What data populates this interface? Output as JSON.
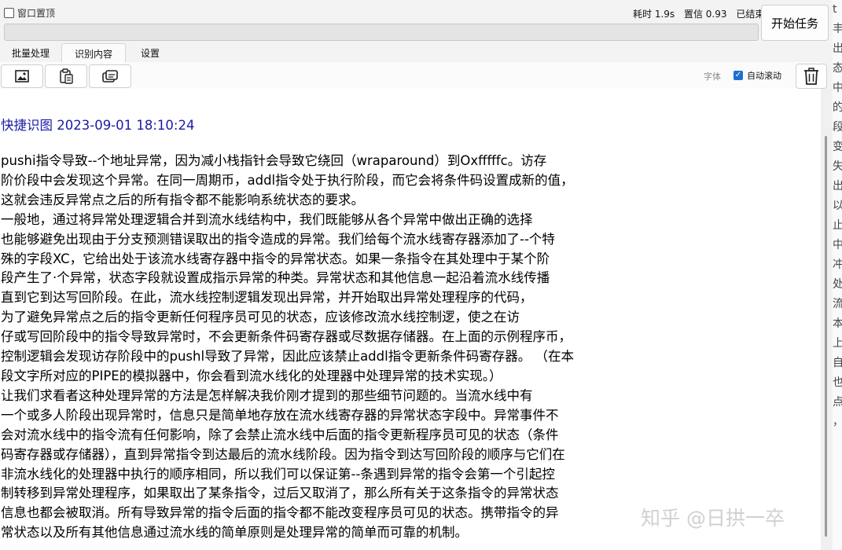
{
  "header": {
    "pin_label": "窗口置顶",
    "time_label": "耗时 1.9s",
    "confidence_label": "置信 0.93",
    "status_label": "已结束",
    "start_button": "开始任务"
  },
  "tabs": [
    {
      "label": "批量处理"
    },
    {
      "label": "识别内容"
    },
    {
      "label": "设置"
    }
  ],
  "toolbar": {
    "font_label": "字体",
    "autoscroll_label": "自动滚动"
  },
  "content": {
    "snap_title": "快捷识图 2023-09-01 18:10:24",
    "lines": [
      "pushi指令导致--个地址异常，因为减小栈指针会导致它绕回（wraparound）到Oxfffffc。访存",
      "阶价段中会发现这个异常。在同一周期币，addl指令处于执行阶段，而它会将条件码设置成新的值，",
      "这就会违反异常点之后的所有指令都不能影响系统状态的要求。",
      "一般地，通过将异常处理逻辑合并到流水线结构中，我们既能够从各个异常中做出正确的选择",
      "也能够避免出现由于分支预测错误取出的指令造成的异常。我们给每个流水线寄存器添加了--个特",
      "殊的字段XC，它给出处于该流水线寄存器中指令的异常状态。如果一条指令在其处理中于某个阶",
      "段产生了·个异常，状态字段就设置成指示异常的种类。异常状态和其他信息一起沿着流水线传播",
      "直到它到达写回阶段。在此，流水线控制逻辑发现出异常，并开始取出异常处理程序的代码，",
      "为了避免异常点之后的指令更新任何程序员可见的状态，应该修改流水线控制逻，使之在访",
      "仔或写回阶段中的指令导致异常时，不会更新条件码寄存器或尽数据存储器。在上面的示例程序币，",
      "控制逻辑会发现访存阶段中的pushl导致了异常，因此应该禁止addl指令更新条件码寄存器。 （在本",
      "段文字所对应的PIPE的模拟器中，你会看到流水线化的处理器中处理异常的技术实现。）",
      "让我们求看者这种处理异常的方法是怎样解决我价刚才提到的那些细节问题的。当流水线中有",
      "一个或多人阶段出现异常时，信息只是简单地存放在流水线寄存器的异常状态字段中。异常事件不",
      "会对流水线中的指令流有任何影响，除了会禁止流水线中后面的指令更新程序员可见的状态（条件",
      "码寄存器或存储器），直到异常指令到达最后的流水线阶段。因为指令到达写回阶段的顺序与它们在",
      "非流水线化的处理器中执行的顺序相同，所以我们可以保证第--条遇到异常的指令会第一个引起控",
      "制转移到异常处理程序，如果取出了某条指令，过后又取消了，那么所有关于这条指令的异常状态",
      "信息也都会被取消。所有导致异常的指令后面的指令都不能改变程序员可见的状态。携带指令的异",
      "常状态以及所有其他信息通过流水线的简单原则是处理异常的简单而可靠的机制。"
    ]
  },
  "watermark": "知乎 @日拱一卒",
  "edge_chars": [
    "t",
    "丰",
    "出",
    "态",
    "中",
    "的",
    "段",
    "变",
    "失",
    "出",
    "以",
    "止",
    "中",
    "冲",
    "处",
    "流",
    "本",
    "上",
    "自",
    "也",
    "点",
    "，"
  ],
  "colors": {
    "snap_title": "#1a1aa8",
    "checkbox_accent": "#1f6fd1"
  },
  "icons": [
    "image-icon",
    "paste-icon",
    "copy-icon",
    "trash-icon"
  ]
}
